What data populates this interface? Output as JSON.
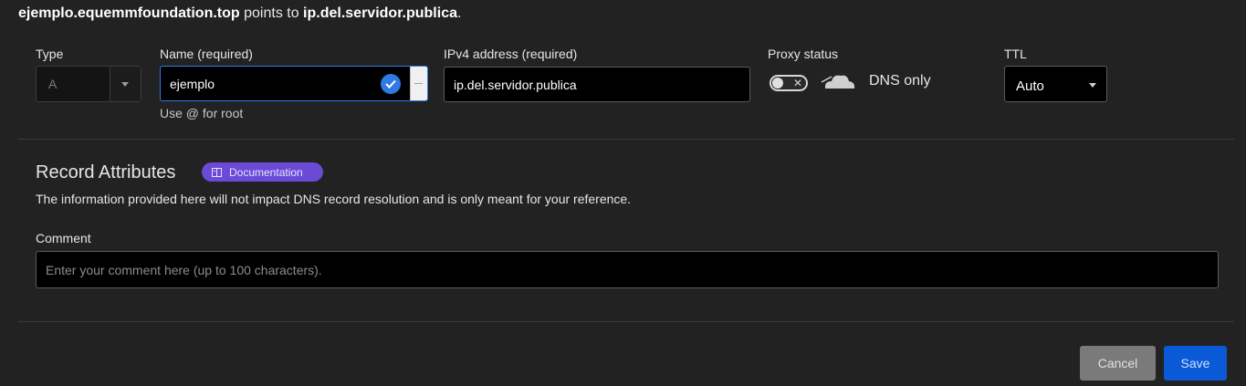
{
  "summary": {
    "name": "ejemplo.equemmfoundation.top",
    "mid": " points to ",
    "target": "ip.del.servidor.publica",
    "end": "."
  },
  "fields": {
    "type": {
      "label": "Type",
      "value": "A"
    },
    "name": {
      "label": "Name (required)",
      "value": "ejemplo",
      "hint": "Use @ for root"
    },
    "ipv4": {
      "label": "IPv4 address (required)",
      "value": "ip.del.servidor.publica"
    },
    "proxy": {
      "label": "Proxy status",
      "state_label": "DNS only",
      "enabled": false
    },
    "ttl": {
      "label": "TTL",
      "value": "Auto"
    }
  },
  "attributes": {
    "title": "Record Attributes",
    "doc_badge": "Documentation",
    "info": "The information provided here will not impact DNS record resolution and is only meant for your reference.",
    "comment_label": "Comment",
    "comment_placeholder": "Enter your comment here (up to 100 characters)."
  },
  "actions": {
    "cancel": "Cancel",
    "save": "Save"
  },
  "icons": {
    "check": "check-circle-icon",
    "cloud": "cloud-icon",
    "toggle_off": "x-icon",
    "doc": "book-icon",
    "dropdown": "chevron-down-icon"
  },
  "colors": {
    "background": "#222222",
    "accent_blue": "#2f7ae5",
    "save_button": "#0a59d6",
    "doc_badge": "#6b4ad6",
    "cancel_button": "#7a7a7a"
  }
}
